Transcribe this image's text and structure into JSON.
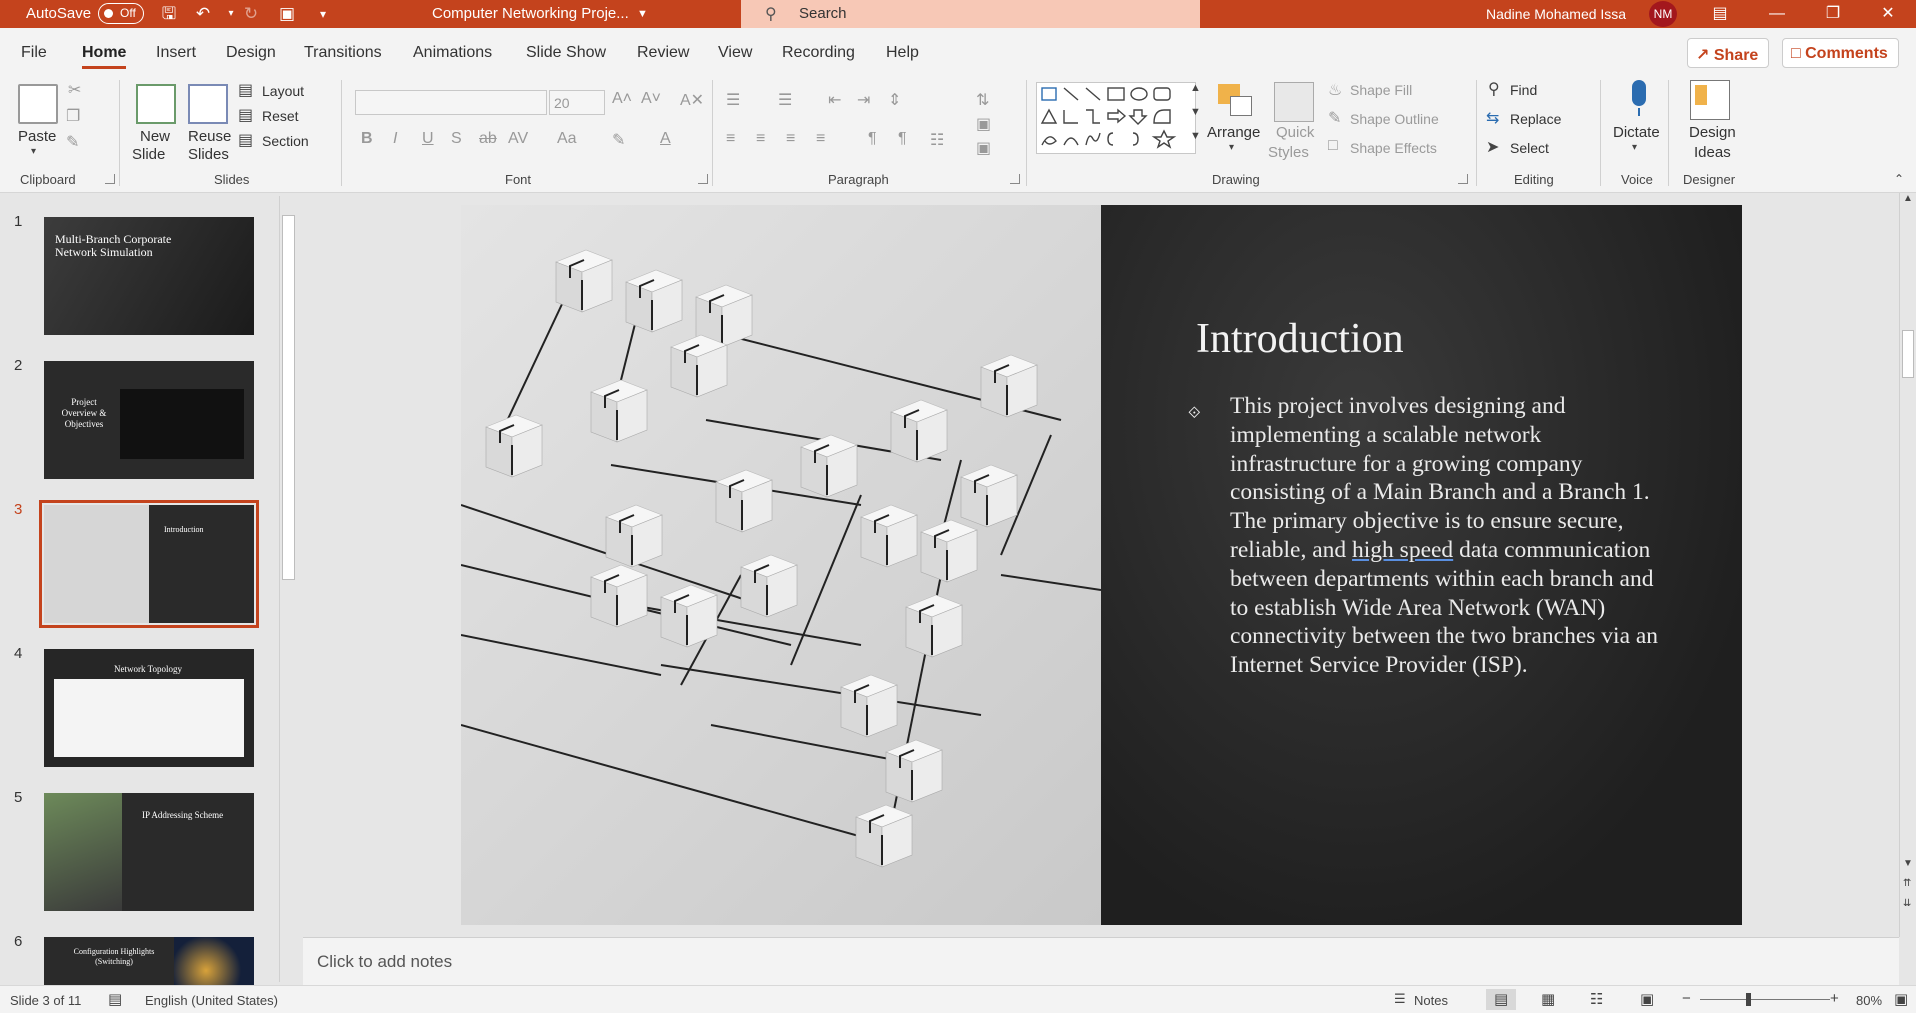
{
  "titlebar": {
    "autosave_label": "AutoSave",
    "autosave_state": "Off",
    "doc_title": "Computer Networking Proje...",
    "search_placeholder": "Search",
    "user_name": "Nadine Mohamed Issa",
    "user_initials": "NM"
  },
  "menu": {
    "tabs": [
      "File",
      "Home",
      "Insert",
      "Design",
      "Transitions",
      "Animations",
      "Slide Show",
      "Review",
      "View",
      "Recording",
      "Help"
    ],
    "active": "Home",
    "share": "Share",
    "comments": "Comments"
  },
  "ribbon": {
    "clipboard": {
      "paste": "Paste",
      "group": "Clipboard"
    },
    "slides": {
      "new_slide_1": "New",
      "new_slide_2": "Slide",
      "reuse_1": "Reuse",
      "reuse_2": "Slides",
      "layout": "Layout",
      "reset": "Reset",
      "section": "Section",
      "group": "Slides"
    },
    "font": {
      "size": "20",
      "group": "Font",
      "bold": "B",
      "italic": "I",
      "underline": "U",
      "shadow": "S",
      "strike": "ab",
      "spacing": "AV",
      "case": "Aa"
    },
    "paragraph": {
      "group": "Paragraph"
    },
    "drawing": {
      "arrange": "Arrange",
      "quick_1": "Quick",
      "quick_2": "Styles",
      "shape_fill": "Shape Fill",
      "shape_outline": "Shape Outline",
      "shape_effects": "Shape Effects",
      "group": "Drawing"
    },
    "editing": {
      "find": "Find",
      "replace": "Replace",
      "select": "Select",
      "group": "Editing"
    },
    "voice": {
      "dictate": "Dictate",
      "group": "Voice"
    },
    "designer": {
      "ideas_1": "Design",
      "ideas_2": "Ideas",
      "group": "Designer"
    }
  },
  "thumbnails": [
    {
      "num": "1",
      "title": "Multi-Branch Corporate Network Simulation"
    },
    {
      "num": "2",
      "title": "Project Overview & Objectives"
    },
    {
      "num": "3",
      "title": "Introduction"
    },
    {
      "num": "4",
      "title": "Network Topology"
    },
    {
      "num": "5",
      "title": "IP Addressing Scheme"
    },
    {
      "num": "6",
      "title": "Configuration Highlights (Switching)"
    }
  ],
  "selected_slide": 3,
  "slide": {
    "title": "Introduction",
    "body_before": "This project involves designing and implementing a scalable network infrastructure for a growing company consisting of a Main Branch and a Branch 1. The primary objective is to ensure secure, reliable, and ",
    "body_link": "high speed",
    "body_after": " data communication between departments within each branch and to establish Wide Area Network (WAN) connectivity between the two branches via an Internet Service Provider (ISP)."
  },
  "notes_placeholder": "Click to add notes",
  "status": {
    "slide_of": "Slide 3 of 11",
    "language": "English (United States)",
    "notes": "Notes",
    "zoom": "80%"
  },
  "colors": {
    "accent": "#c4431d"
  }
}
